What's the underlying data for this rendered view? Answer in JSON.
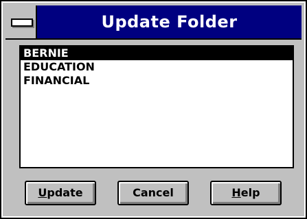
{
  "window": {
    "title": "Update Folder"
  },
  "listbox": {
    "items": [
      {
        "label": "BERNIE",
        "selected": true
      },
      {
        "label": "EDUCATION",
        "selected": false
      },
      {
        "label": "FINANCIAL",
        "selected": false
      }
    ]
  },
  "buttons": {
    "update": {
      "mnemonic": "U",
      "rest": "pdate"
    },
    "cancel": {
      "label": "Cancel"
    },
    "help": {
      "mnemonic": "H",
      "rest": "elp"
    }
  },
  "icons": {
    "system_menu": "system-menu-icon"
  },
  "colors": {
    "title_bar": "#000080",
    "face": "#c0c0c0",
    "selection": "#000000"
  }
}
